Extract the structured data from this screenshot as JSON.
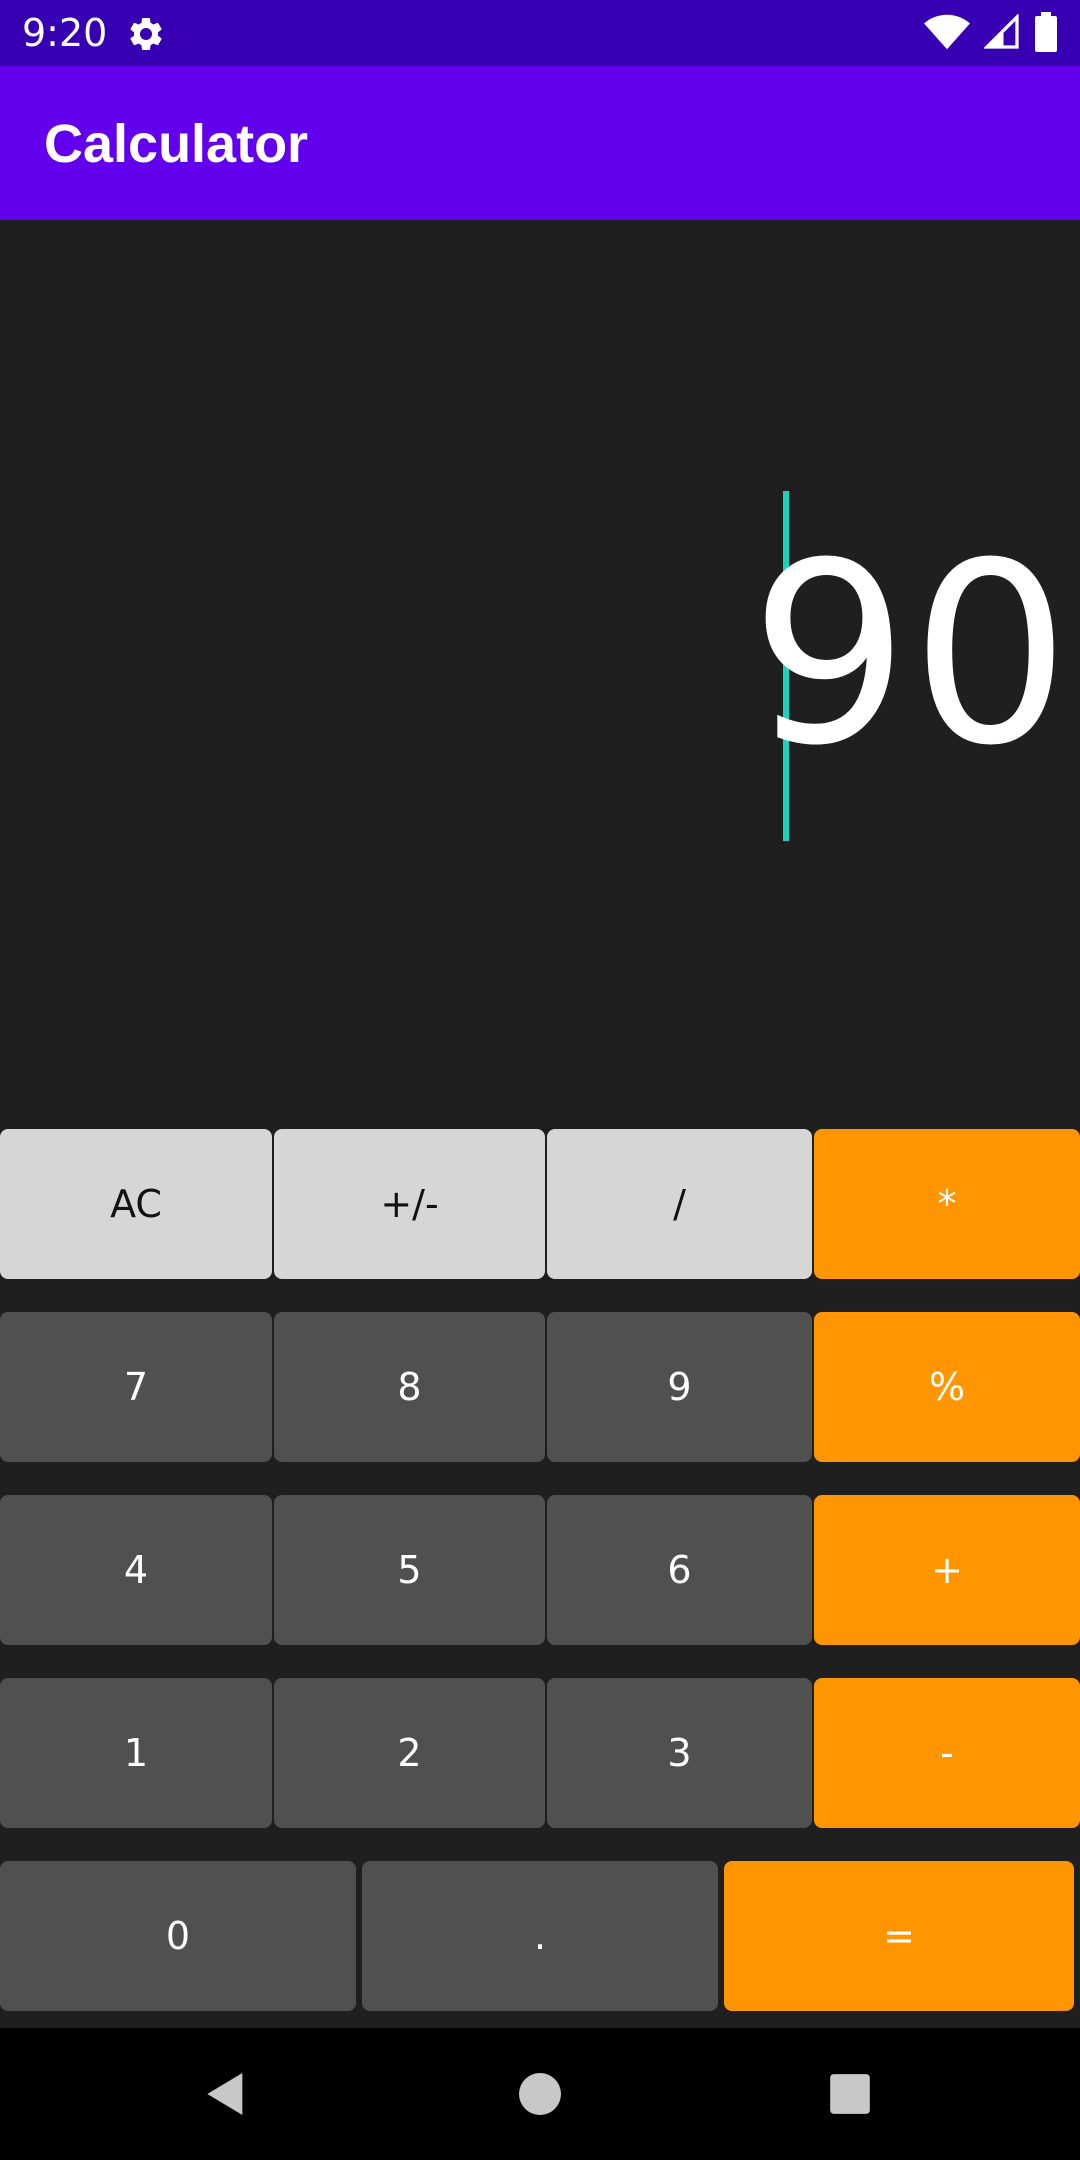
{
  "status_bar": {
    "time": "9:20",
    "icons": [
      "gear-icon",
      "wifi-icon",
      "signal-icon",
      "battery-icon"
    ]
  },
  "app_bar": {
    "title": "Calculator"
  },
  "display": {
    "value": "90"
  },
  "keypad": {
    "row1": [
      "AC",
      "+/-",
      "/",
      "*"
    ],
    "row2": [
      "7",
      "8",
      "9",
      "%"
    ],
    "row3": [
      "4",
      "5",
      "6",
      "+"
    ],
    "row4": [
      "1",
      "2",
      "3",
      "-"
    ],
    "row5": [
      "0",
      ".",
      "="
    ]
  },
  "nav_bar": {
    "icons": [
      "back-icon",
      "home-icon",
      "recents-icon"
    ]
  },
  "colors": {
    "status_bar": "#3700b3",
    "app_bar": "#6200ee",
    "background": "#1f1f1f",
    "key_light": "#d6d6d6",
    "key_dark": "#505050",
    "key_operator": "#ff9500",
    "cursor": "#1ad1c2"
  }
}
